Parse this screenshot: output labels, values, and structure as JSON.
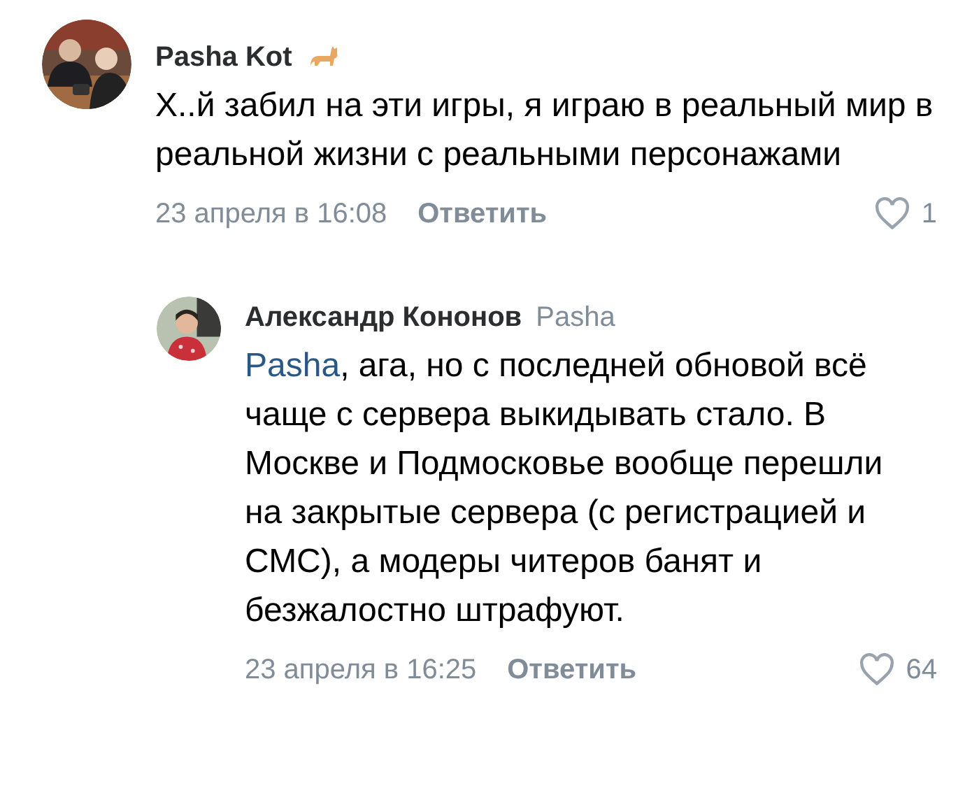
{
  "comments": [
    {
      "author": "Pasha Kot",
      "text": "Х..й забил на эти игры, я играю в реальный мир в реальной жизни с реальными персонажами",
      "date": "23 апреля в 16:08",
      "reply_label": "Ответить",
      "liked": false,
      "likes": "1",
      "nested": false
    },
    {
      "author": "Александр Кононов",
      "reply_to": "Pasha",
      "mention": "Pasha",
      "text": ", ага, но с последней обновой всё чаще с сервера выкидывать стало. В Москве и Подмосковье вообще перешли на закрытые сервера (с регистрацией и СМС), а модеры читеров банят и  безжалостно штрафуют.",
      "date": "23 апреля в 16:25",
      "reply_label": "Ответить",
      "liked": false,
      "likes": "64",
      "nested": true
    }
  ]
}
